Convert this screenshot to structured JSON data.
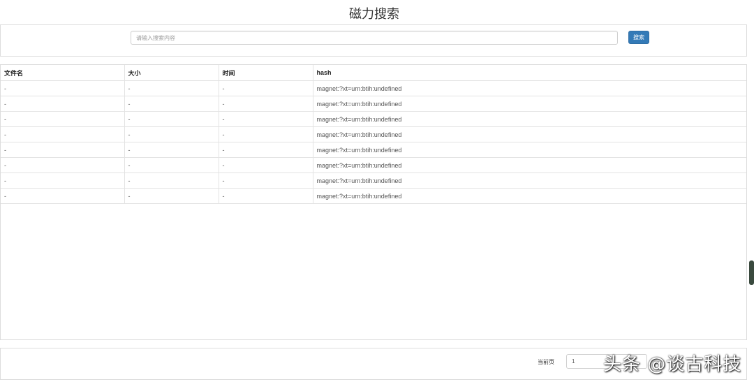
{
  "header": {
    "title": "磁力搜索"
  },
  "search": {
    "placeholder": "请输入搜索内容",
    "button_label": "搜索"
  },
  "table": {
    "columns": [
      "文件名",
      "大小",
      "时间",
      "hash"
    ],
    "rows": [
      [
        "-",
        "-",
        "-",
        "magnet:?xt=urn:btih:undefined"
      ],
      [
        "-",
        "-",
        "-",
        "magnet:?xt=urn:btih:undefined"
      ],
      [
        "-",
        "-",
        "-",
        "magnet:?xt=urn:btih:undefined"
      ],
      [
        "-",
        "-",
        "-",
        "magnet:?xt=urn:btih:undefined"
      ],
      [
        "-",
        "-",
        "-",
        "magnet:?xt=urn:btih:undefined"
      ],
      [
        "-",
        "-",
        "-",
        "magnet:?xt=urn:btih:undefined"
      ],
      [
        "-",
        "-",
        "-",
        "magnet:?xt=urn:btih:undefined"
      ],
      [
        "-",
        "-",
        "-",
        "magnet:?xt=urn:btih:undefined"
      ]
    ]
  },
  "pagination": {
    "label": "当前页",
    "current_page": "1"
  },
  "watermark": {
    "text": "头条 @谈古科技"
  },
  "colors": {
    "primary_button": "#337ab7",
    "border": "#dcdcdc"
  }
}
